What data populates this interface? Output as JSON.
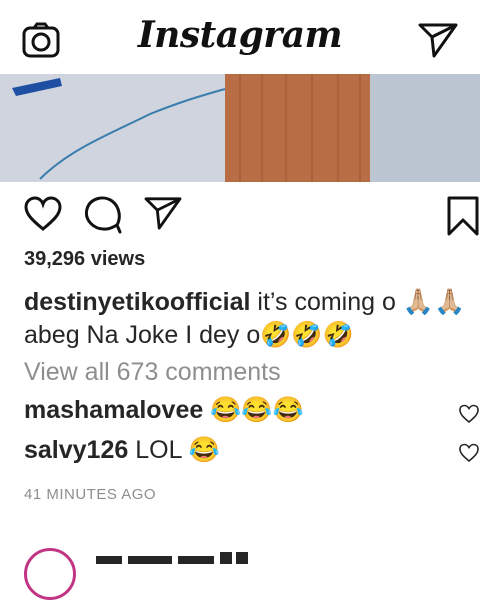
{
  "header": {
    "logo": "Instagram",
    "camera_icon": "camera-icon",
    "direct_icon": "paper-plane-icon"
  },
  "post": {
    "views": "39,296 views",
    "caption": {
      "username": "destinyetikoofficial",
      "text": " it’s coming o 🙏🏼🙏🏼 abeg Na Joke I dey o🤣🤣🤣"
    },
    "view_all": "View all 673 comments",
    "comments": [
      {
        "username": "mashamalovee",
        "text": " 😂😂😂"
      },
      {
        "username": "salvy126",
        "text": " LOL 😂"
      }
    ],
    "timestamp": "41 MINUTES AGO"
  },
  "colors": {
    "text": "#262626",
    "muted": "#8e8e8e",
    "divider": "#dbdbdb",
    "story_ring": "#c13584"
  }
}
